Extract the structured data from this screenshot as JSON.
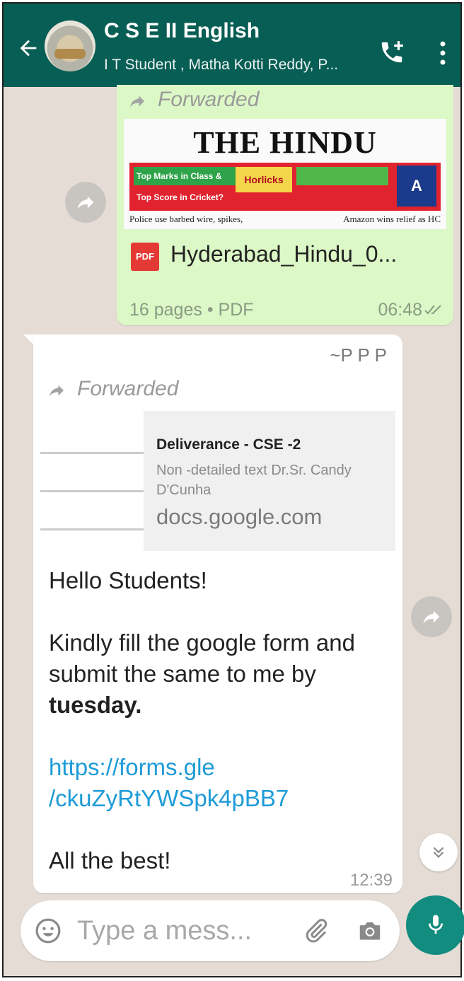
{
  "header": {
    "title": "C S E II English",
    "subtitle": "I T Student , Matha Kotti Reddy, P..."
  },
  "messages": [
    {
      "direction": "outgoing",
      "forwarded_label": "Forwarded",
      "preview": {
        "masthead": "THE HINDU",
        "ad_line_1": "Top Marks in Class &",
        "ad_line_2": "Top Score in Cricket?",
        "ad_brand": "Horlicks",
        "ad_logo": "A",
        "headline_1": "Police use barbed wire, spikes,",
        "headline_2": "Amazon wins relief as HC"
      },
      "file_name": "Hyderabad_Hindu_0...",
      "file_icon_label": "PDF",
      "file_meta": "16 pages • PDF",
      "time": "06:48",
      "status": "read"
    },
    {
      "direction": "incoming",
      "sender": "~P P P",
      "forwarded_label": "Forwarded",
      "link_preview": {
        "title": "Deliverance - CSE -2",
        "description": "Non -detailed text Dr.Sr. Candy D'Cunha",
        "domain": "docs.google.com"
      },
      "greeting": "Hello Students!",
      "body_text": "Kindly fill the google form and submit the same to me by ",
      "body_bold": "tuesday.",
      "link_line_1": "https://forms.gle",
      "link_line_2": "/ckuZyRtYWSpk4pBB7",
      "closing": "All the best!",
      "time": "12:39"
    }
  ],
  "composer": {
    "placeholder": "Type a mess..."
  },
  "colors": {
    "header_bg": "#075e54",
    "outgoing_bubble": "#dcf8c6",
    "chat_bg": "#e5ddd5",
    "link": "#1e9bd7",
    "mic_button": "#128c7e"
  }
}
